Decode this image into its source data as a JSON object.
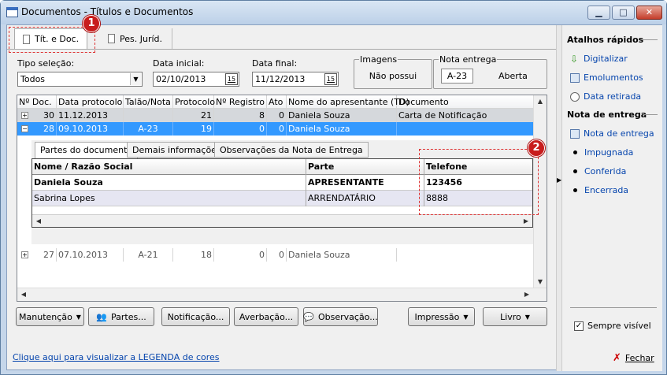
{
  "window": {
    "title": "Documentos - Títulos e Documentos"
  },
  "tabs": [
    {
      "label": "Tít. e Doc."
    },
    {
      "label": "Pes. Juríd."
    }
  ],
  "badges": [
    "1",
    "2"
  ],
  "filters": {
    "tipo_label": "Tipo seleção:",
    "tipo_value": "Todos",
    "inicial_label": "Data inicial:",
    "inicial_value": "02/10/2013",
    "final_label": "Data final:",
    "final_value": "11/12/2013",
    "cal_glyph": "15",
    "imagens_title": "Imagens",
    "imagens_value": "Não possui",
    "nota_title": "Nota entrega",
    "nota_number": "A-23",
    "nota_status": "Aberta"
  },
  "grid": {
    "columns": [
      "Nº Doc.",
      "Data protocolo",
      "Talão/Nota",
      "Protocolo",
      "Nº Registro",
      "Ato",
      "Nome do apresentante (TD)",
      "Documento"
    ],
    "rows": [
      {
        "exp": "+",
        "doc": "30",
        "data": "11.12.2013",
        "talao": "",
        "protocolo": "21",
        "registro": "8",
        "ato": "0",
        "nome": "Daniela Souza",
        "documento": "Carta de Notificação"
      },
      {
        "exp": "−",
        "doc": "28",
        "data": "09.10.2013",
        "talao": "A-23",
        "protocolo": "19",
        "registro": "0",
        "ato": "0",
        "nome": "Daniela Souza",
        "documento": ""
      },
      {
        "exp": "+",
        "doc": "27",
        "data": "07.10.2013",
        "talao": "A-21",
        "protocolo": "18",
        "registro": "0",
        "ato": "0",
        "nome": "Daniela Souza",
        "documento": ""
      }
    ],
    "detail_tabs": [
      "Partes do documento",
      "Demais informações",
      "Observações da Nota de Entrega"
    ],
    "detail_columns": [
      "Nome / Razão Social",
      "Parte",
      "Telefone"
    ],
    "detail_rows": [
      {
        "nome": "Daniela Souza",
        "parte": "APRESENTANTE",
        "telefone": "123456"
      },
      {
        "nome": "Sabrina Lopes",
        "parte": "ARRENDATÁRIO",
        "telefone": "8888"
      }
    ]
  },
  "buttons": {
    "manutencao": "Manutenção",
    "partes": "Partes...",
    "notificacao": "Notificação...",
    "averbacao": "Averbação...",
    "observacao": "Observação...",
    "impressao": "Impressão",
    "livro": "Livro"
  },
  "legend_link": "Clique aqui para visualizar a LEGENDA de cores",
  "sidebar": {
    "atalhos_title": "Atalhos rápidos",
    "atalhos": [
      {
        "label": "Digitalizar"
      },
      {
        "label": "Emolumentos"
      },
      {
        "label": "Data retirada"
      }
    ],
    "nota_title": "Nota de entrega",
    "nota_items": [
      {
        "label": "Nota de entrega"
      },
      {
        "label": "Impugnada"
      },
      {
        "label": "Conferida"
      },
      {
        "label": "Encerrada"
      }
    ],
    "sempre_visivel": "Sempre visível",
    "fechar": "Fechar"
  },
  "colors": {
    "selected_row": "#3399ff",
    "odd_row": "#d5d8dc",
    "link": "#0645ad"
  }
}
